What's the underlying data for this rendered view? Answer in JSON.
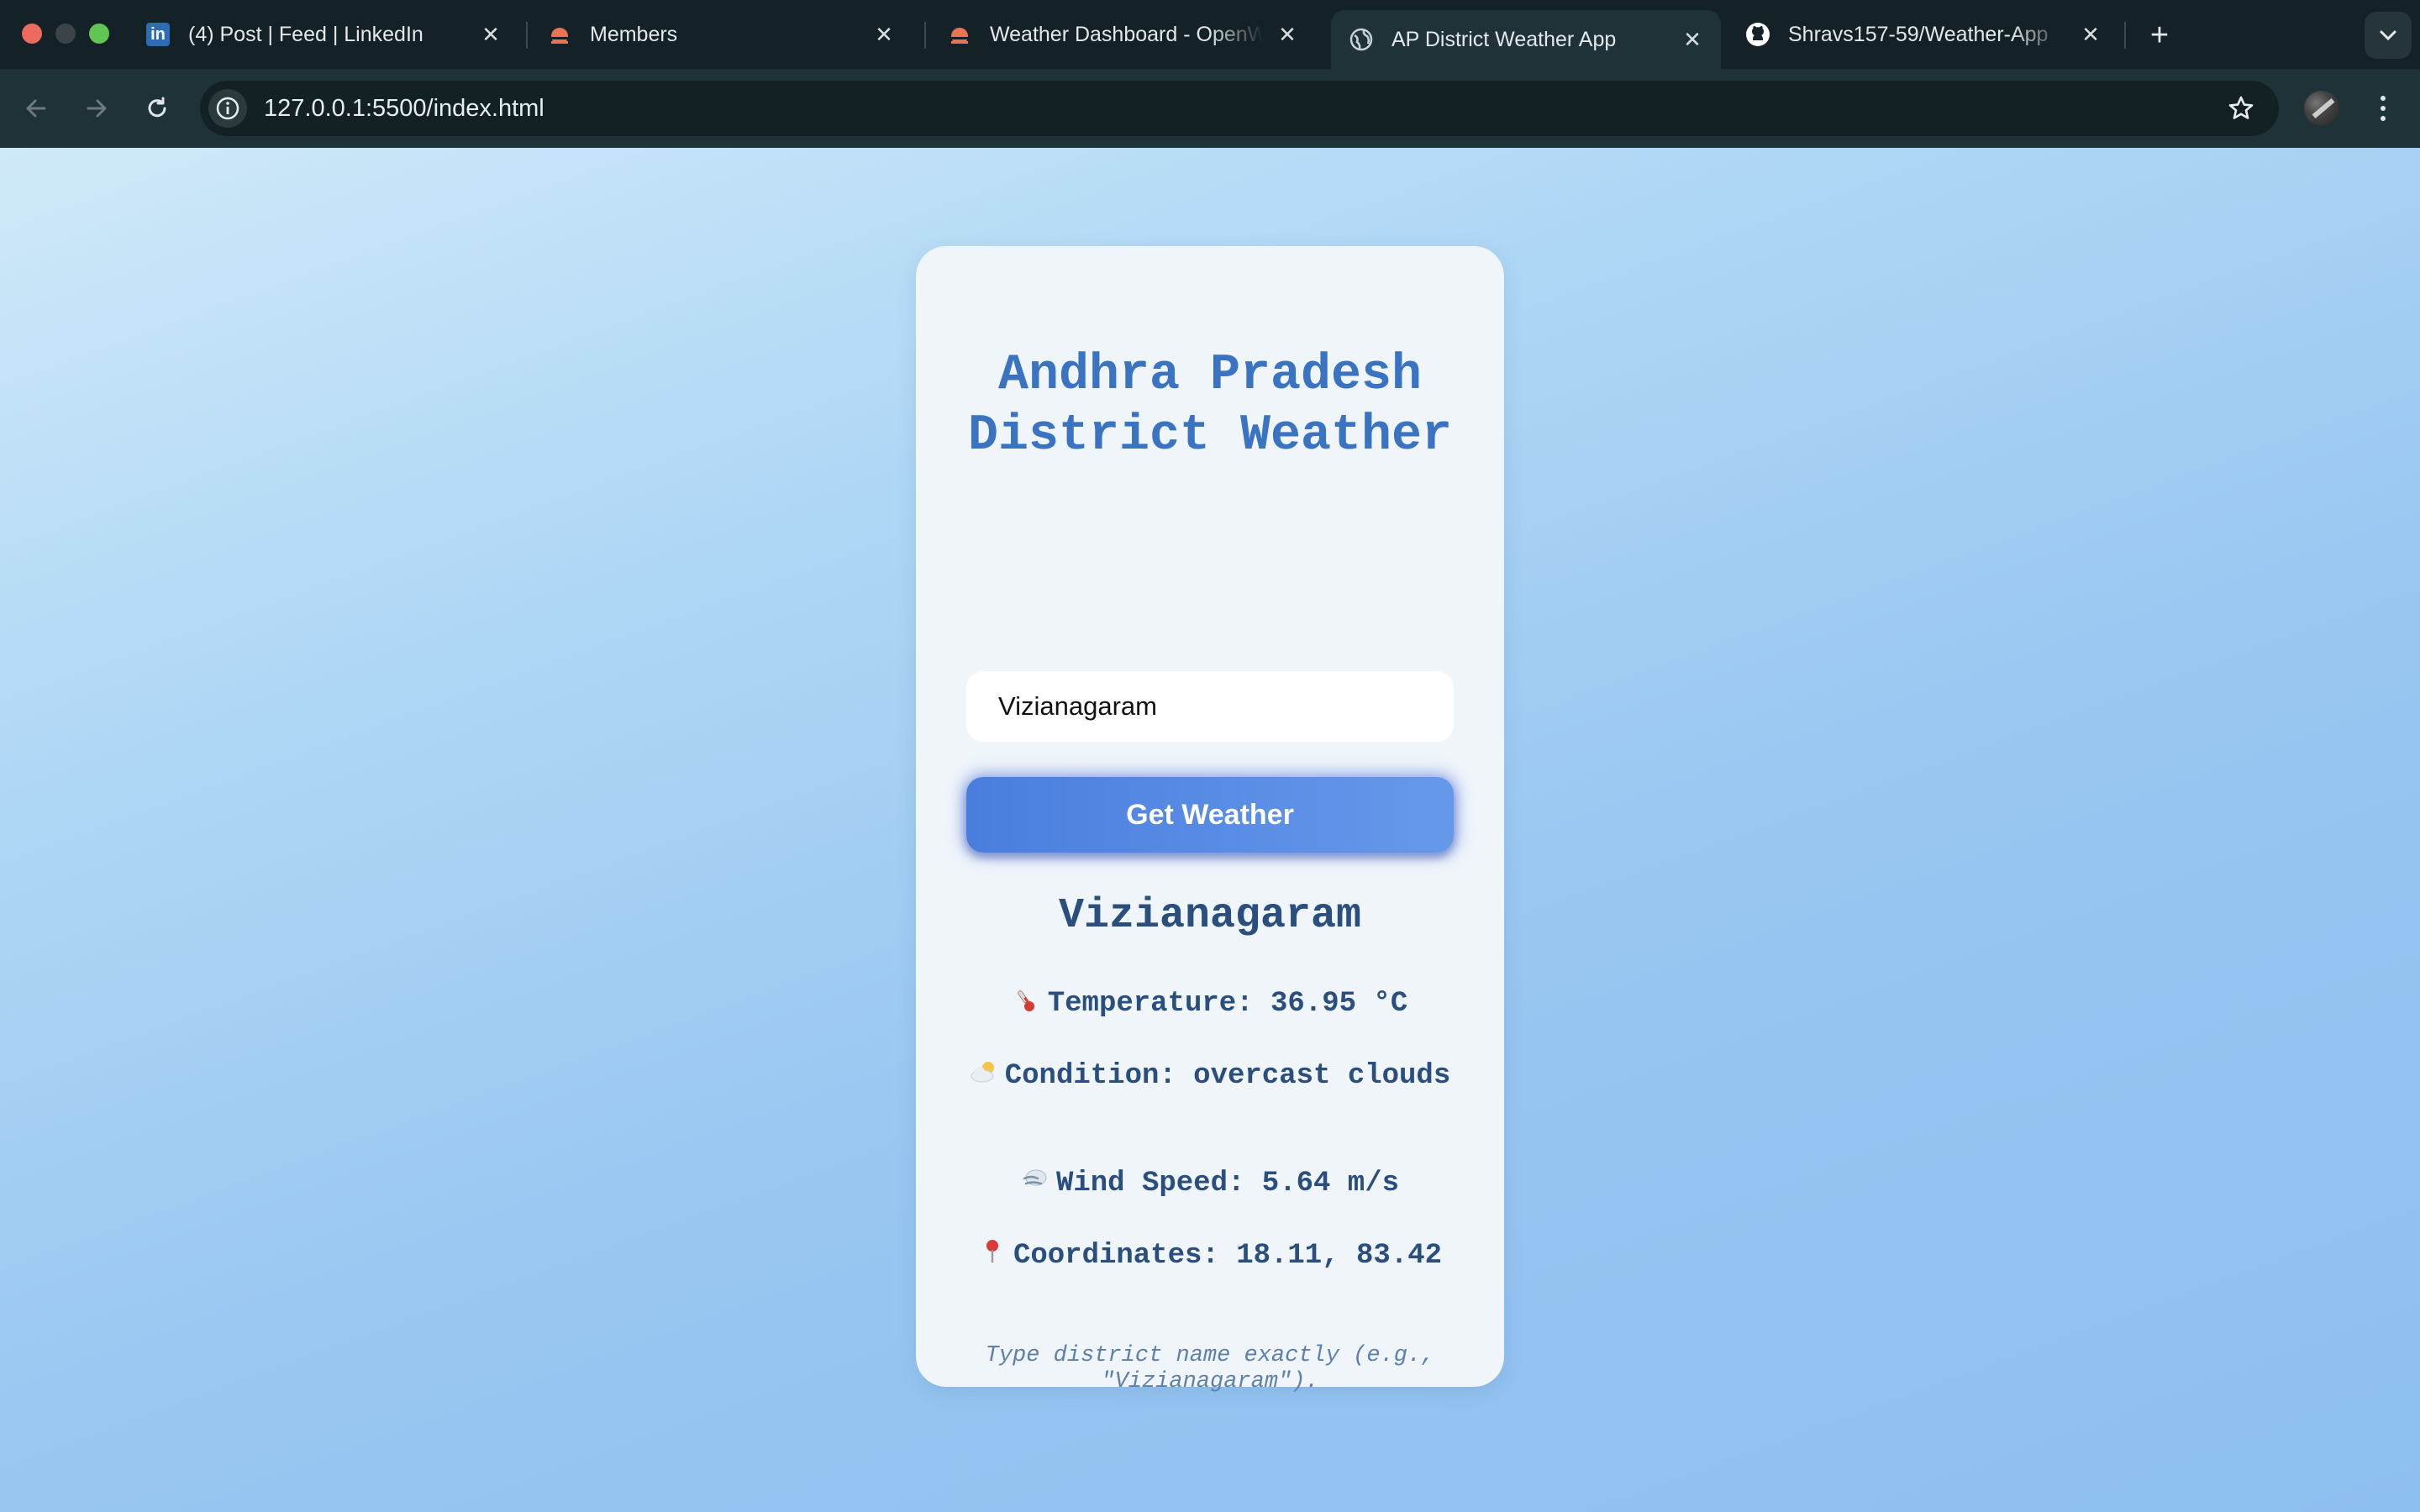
{
  "browser": {
    "tabs": [
      {
        "label": "(4) Post | Feed | LinkedIn",
        "icon": "linkedin-icon",
        "active": false
      },
      {
        "label": "Members",
        "icon": "openweather-icon",
        "active": false
      },
      {
        "label": "Weather Dashboard - OpenWeather",
        "icon": "openweather-icon",
        "active": false
      },
      {
        "label": "AP District Weather App",
        "icon": "globe-icon",
        "active": true
      },
      {
        "label": "Shravs157-59/Weather-App",
        "icon": "github-icon",
        "active": false
      }
    ],
    "linkedin_glyph": "in",
    "url": "127.0.0.1:5500/index.html",
    "accent_colors": {
      "tabbar_bg": "#142126",
      "toolbar_bg": "#1f3238",
      "traffic_red": "#ed6a5e",
      "traffic_green": "#61c554",
      "openweather_orange": "#e9744f"
    }
  },
  "app": {
    "title": "Andhra Pradesh District Weather",
    "input": {
      "value": "Vizianagaram",
      "placeholder": ""
    },
    "button_label": "Get Weather",
    "result": {
      "city": "Vizianagaram",
      "temperature": {
        "emoji": "thermometer-icon",
        "text": "Temperature: 36.95 °C"
      },
      "condition": {
        "emoji": "cloud-sun-icon",
        "text": "Condition: overcast clouds"
      },
      "wind": {
        "emoji": "wind-icon",
        "text": "Wind Speed: 5.64 m/s"
      },
      "coordinates": {
        "emoji": "pin-icon",
        "text": "Coordinates: 18.11, 83.42"
      }
    },
    "hint": "Type district name exactly (e.g., \"Vizianagaram\").",
    "colors": {
      "title": "#3a73c2",
      "result_text": "#2a4f7e",
      "button_start": "#4a7ede",
      "button_end": "#6698ea",
      "card_bg": "#f0f5fa"
    }
  }
}
